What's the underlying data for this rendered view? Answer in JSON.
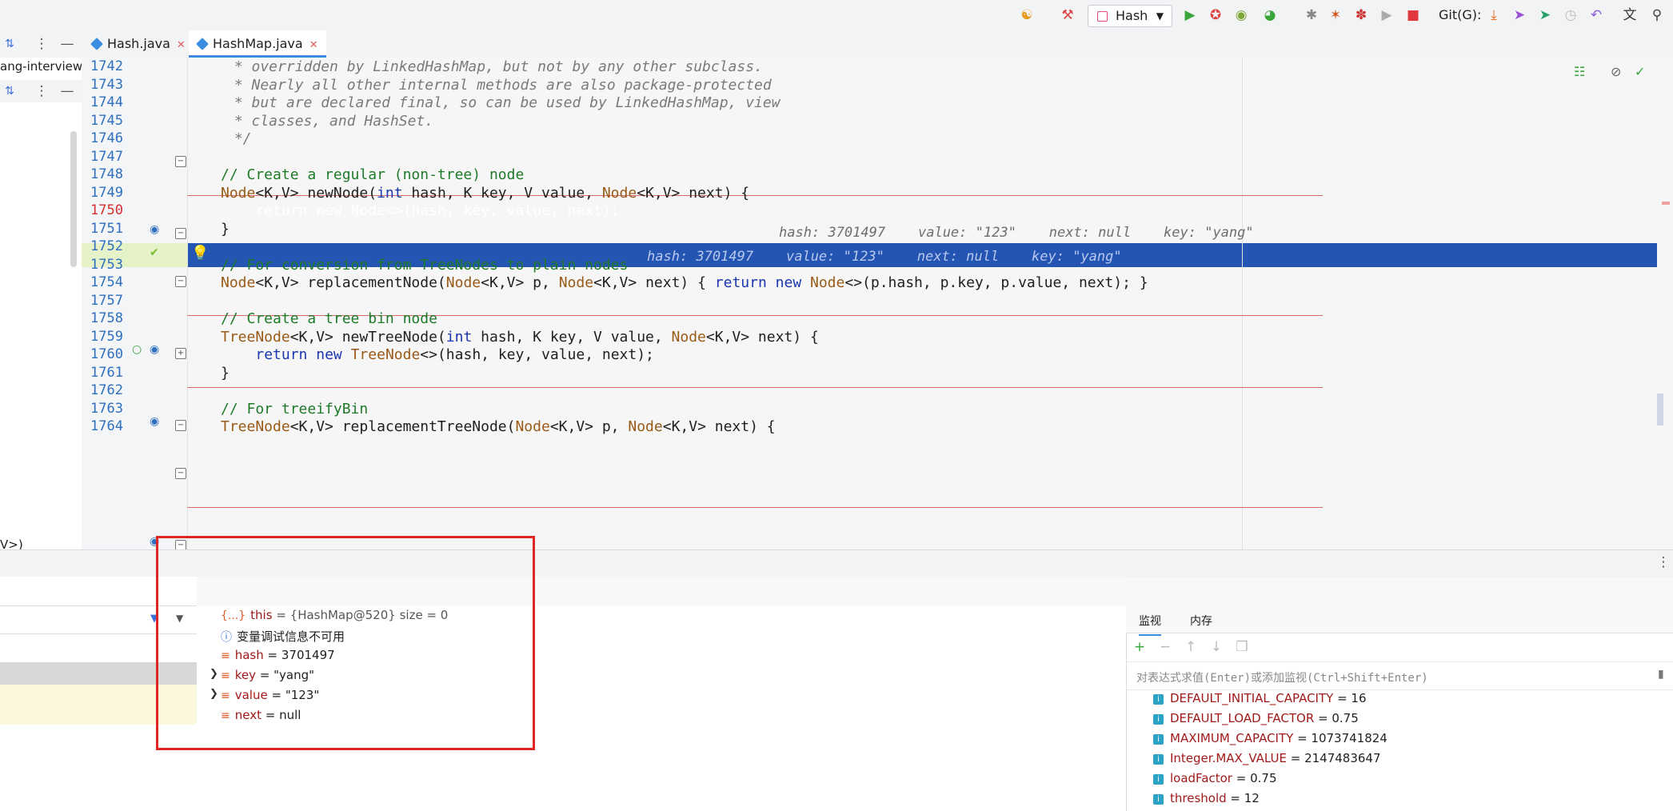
{
  "toolbar": {
    "run_config": "Hash",
    "git_label": "Git(G):"
  },
  "tabs": [
    {
      "label": "Hash.java"
    },
    {
      "label": "HashMap.java"
    }
  ],
  "project": {
    "breadcrumb": "ang-interview",
    "signature_frag": "V>)"
  },
  "editor": {
    "lines": [
      {
        "n": "1742",
        "text": " * overridden by LinkedHashMap, but not by any other subclass."
      },
      {
        "n": "1743",
        "text": " * Nearly all other internal methods are also package-protected"
      },
      {
        "n": "1744",
        "text": " * but are declared final, so can be used by LinkedHashMap, view"
      },
      {
        "n": "1745",
        "text": " * classes, and HashSet."
      },
      {
        "n": "1746",
        "text": " */"
      },
      {
        "n": "1747",
        "text": ""
      },
      {
        "n": "1748",
        "text": "// Create a regular (non-tree) node"
      },
      {
        "n": "1749",
        "text": "Node<K,V> newNode(int hash, K key, V value, Node<K,V> next) {"
      },
      {
        "n": "1750",
        "text": "    return new Node<>(hash, key, value, next);"
      },
      {
        "n": "1751",
        "text": "}"
      },
      {
        "n": "1752",
        "text": ""
      },
      {
        "n": "1753",
        "text": "// For conversion from TreeNodes to plain nodes"
      },
      {
        "n": "1754",
        "text": "Node<K,V> replacementNode(Node<K,V> p, Node<K,V> next) { return new Node<>(p.hash, p.key, p.value, next); }"
      },
      {
        "n": "1757",
        "text": ""
      },
      {
        "n": "1758",
        "text": "// Create a tree bin node"
      },
      {
        "n": "1759",
        "text": "TreeNode<K,V> newTreeNode(int hash, K key, V value, Node<K,V> next) {"
      },
      {
        "n": "1760",
        "text": "    return new TreeNode<>(hash, key, value, next);"
      },
      {
        "n": "1761",
        "text": "}"
      },
      {
        "n": "1762",
        "text": ""
      },
      {
        "n": "1763",
        "text": "// For treeifyBin"
      },
      {
        "n": "1764",
        "text": "TreeNode<K,V> replacementTreeNode(Node<K,V> p, Node<K,V> next) {"
      }
    ],
    "hint_1749": "hash: 3701497    value: \"123\"    next: null    key: \"yang\"",
    "hint_1750": "hash: 3701497    value: \"123\"    next: null    key: \"yang\""
  },
  "variables": [
    {
      "name": "this",
      "value": " = {HashMap@520}  size = 0"
    },
    {
      "name": "变量调试信息不可用",
      "value": ""
    },
    {
      "name": "hash",
      "value": " = 3701497"
    },
    {
      "name": "key",
      "value": " = \"yang\""
    },
    {
      "name": "value",
      "value": " = \"123\""
    },
    {
      "name": "next",
      "value": " = null"
    }
  ],
  "watch": {
    "tab_watch": "监视",
    "tab_memory": "内存",
    "placeholder": "对表达式求值(Enter)或添加监视(Ctrl+Shift+Enter)",
    "items": [
      {
        "name": "DEFAULT_INITIAL_CAPACITY",
        "value": " = 16"
      },
      {
        "name": "DEFAULT_LOAD_FACTOR",
        "value": " = 0.75"
      },
      {
        "name": "MAXIMUM_CAPACITY",
        "value": " = 1073741824"
      },
      {
        "name": "Integer.MAX_VALUE",
        "value": " = 2147483647"
      },
      {
        "name": "loadFactor",
        "value": " = 0.75"
      },
      {
        "name": "threshold",
        "value": " = 12"
      }
    ]
  }
}
